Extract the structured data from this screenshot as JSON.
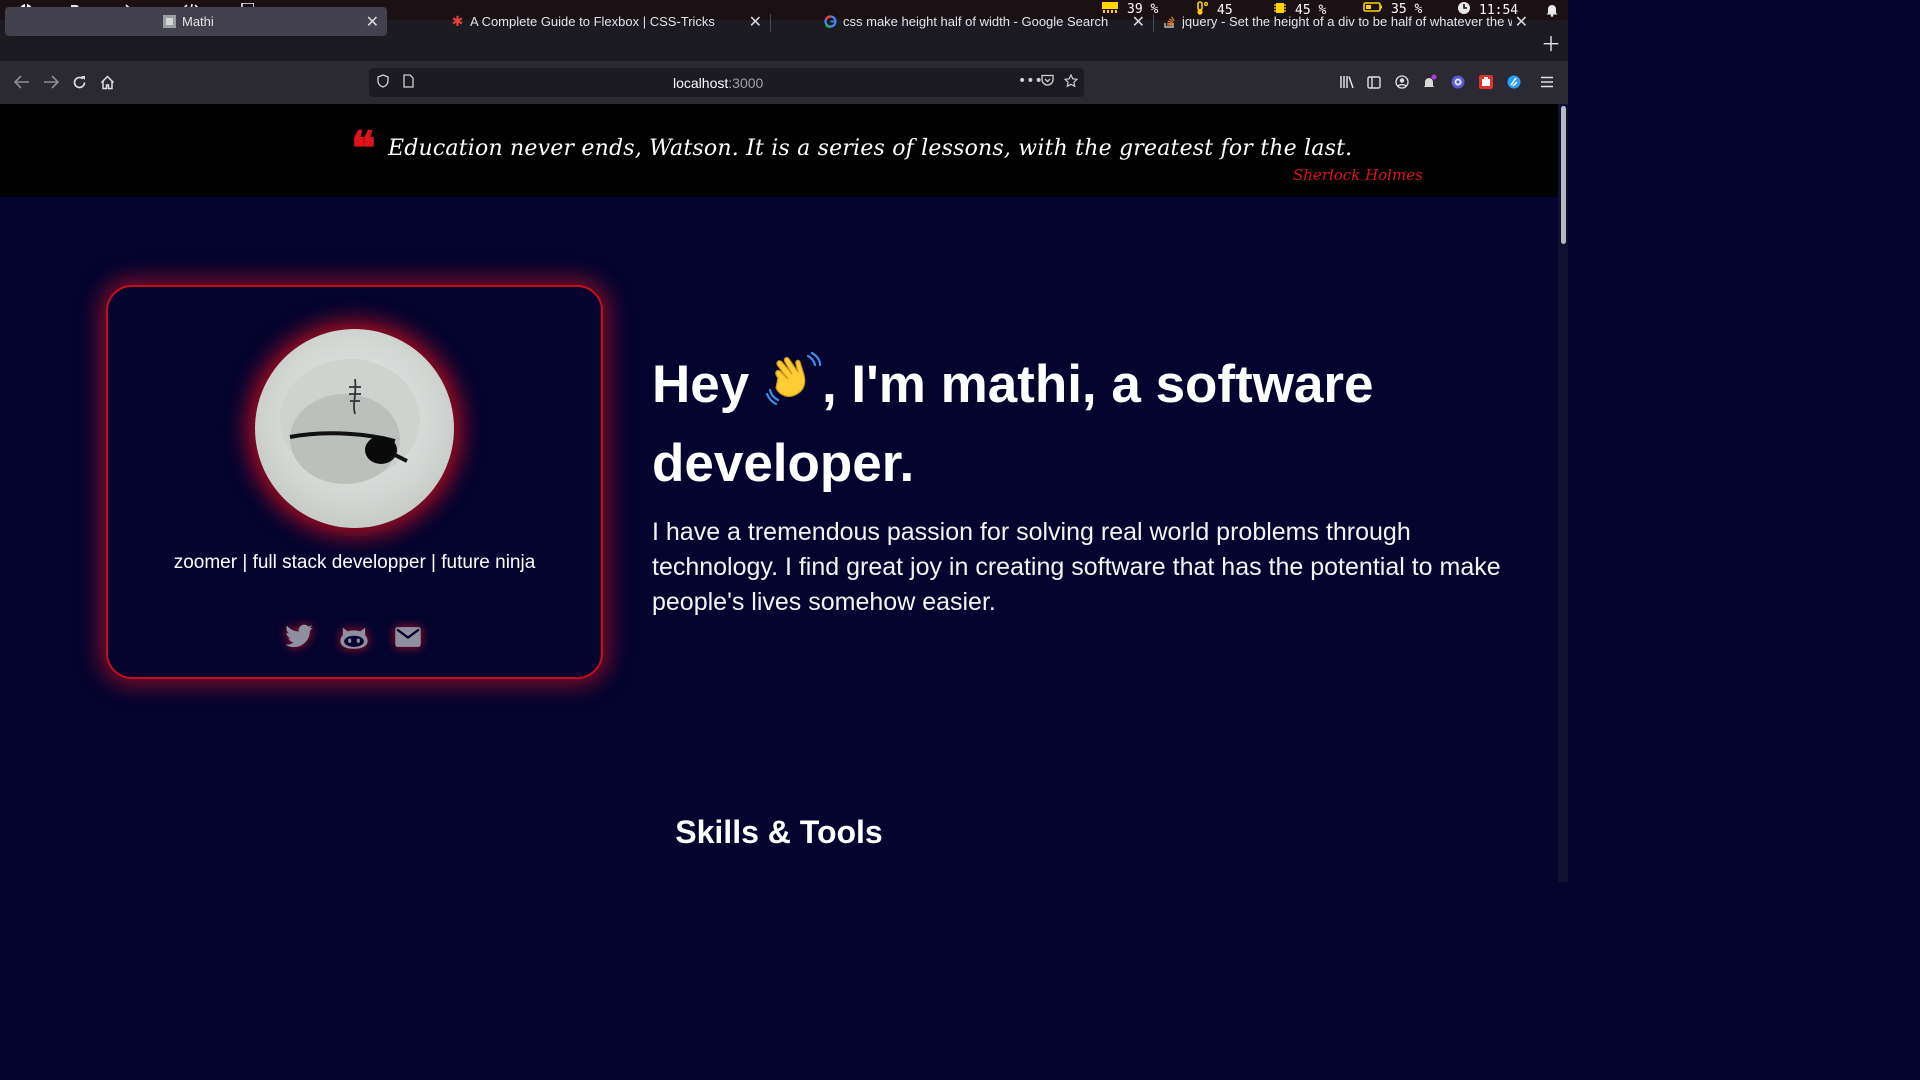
{
  "system_bar": {
    "left_icons": [
      "app-menu-icon",
      "folder-icon",
      "terminal-icon",
      "code-icon",
      "windows-icon"
    ],
    "stats": [
      {
        "icon": "memory-icon",
        "value": "39 %"
      },
      {
        "icon": "temperature-icon",
        "value": "45"
      },
      {
        "icon": "cpu-icon",
        "value": "45 %"
      },
      {
        "icon": "battery-icon",
        "value": "35 %"
      },
      {
        "icon": "clock-icon",
        "value": "11:54"
      }
    ]
  },
  "tabs": [
    {
      "title": "Mathi",
      "active": true
    },
    {
      "title": "A Complete Guide to Flexbox | CSS-Tricks",
      "active": false
    },
    {
      "title": "css make height half of width - Google Search",
      "active": false
    },
    {
      "title": "jquery - Set the height of a div to be half of whatever the width",
      "active": false
    }
  ],
  "address_bar": {
    "host": "localhost",
    "port": ":3000"
  },
  "quote": {
    "text": "Education never ends, Watson. It is a series of lessons, with the greatest for the last.",
    "author": "Sherlock Holmes",
    "mark": "❝"
  },
  "profile": {
    "tagline": "zoomer | full stack developper | future ninja",
    "social": [
      "twitter-icon",
      "github-icon",
      "mail-icon"
    ]
  },
  "hero": {
    "greeting_start": "Hey ",
    "greeting_end": ", I'm mathi, a software developer.",
    "bio": "I have a tremendous passion for solving real world problems through technology. I find great joy in creating software that has the potential to make people's lives somehow easier."
  },
  "skills_heading": "Skills & Tools",
  "colors": {
    "page_bg": "#04042f",
    "accent_red": "#e0121b",
    "quote_band": "#000000",
    "status_yellow": "#ffd400"
  }
}
